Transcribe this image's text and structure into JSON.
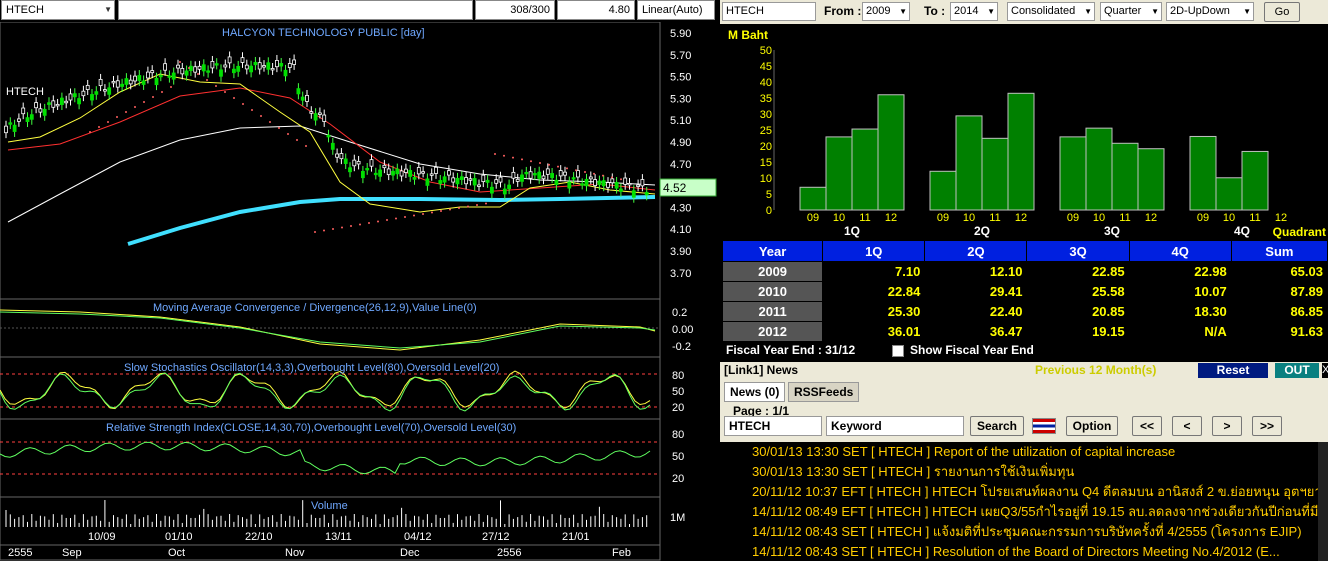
{
  "left_toolbar": {
    "symbol": "HTECH",
    "bars": "308/300",
    "value": "4.80",
    "scale": "Linear(Auto)"
  },
  "chart": {
    "title": "HALCYON TECHNOLOGY PUBLIC [day]",
    "symbol_label": "HTECH",
    "last_price": "4.52",
    "price_ticks": [
      "5.90",
      "5.70",
      "5.50",
      "5.30",
      "5.10",
      "4.90",
      "4.70",
      "4.50",
      "4.30",
      "4.10",
      "3.90",
      "3.70"
    ],
    "macd_title": "Moving Average Convergence / Divergence(26,12,9),Value Line(0)",
    "macd_ticks": [
      "0.2",
      "0.00",
      "-0.2"
    ],
    "stoch_title": "Slow Stochastics Oscillator(14,3,3),Overbought Level(80),Oversold Level(20)",
    "stoch_ticks": [
      "80",
      "50",
      "20"
    ],
    "rsi_title": "Relative Strength Index(CLOSE,14,30,70),Overbought Level(70),Oversold Level(30)",
    "rsi_ticks": [
      "80",
      "50",
      "20"
    ],
    "volume_title": "Volume",
    "volume_tick": "1M",
    "x_labels_top": [
      "10/09",
      "01/10",
      "22/10",
      "13/11",
      "04/12",
      "27/12",
      "21/01"
    ],
    "x_labels_bottom": [
      "2555",
      "Sep",
      "Oct",
      "Nov",
      "Dec",
      "2556",
      "Feb"
    ]
  },
  "right_toolbar": {
    "symbol": "HTECH",
    "from_label": "From :",
    "from_value": "2009",
    "to_label": "To :",
    "to_value": "2014",
    "basis": "Consolidated",
    "period": "Quarter",
    "view": "2D-UpDown",
    "go_label": "Go"
  },
  "chart_data": {
    "type": "bar",
    "ylabel": "M Baht",
    "xlabel": "Quadrant",
    "ylim": [
      0,
      50
    ],
    "y_ticks": [
      "0",
      "5",
      "10",
      "15",
      "20",
      "25",
      "30",
      "35",
      "40",
      "45",
      "50"
    ],
    "groups": [
      "1Q",
      "2Q",
      "3Q",
      "4Q"
    ],
    "years": [
      "09",
      "10",
      "11",
      "12"
    ],
    "values": {
      "1Q": [
        7.1,
        22.84,
        25.3,
        36.01
      ],
      "2Q": [
        12.1,
        29.41,
        22.4,
        36.47
      ],
      "3Q": [
        22.85,
        25.58,
        20.85,
        19.15
      ],
      "4Q": [
        22.98,
        10.07,
        18.3,
        null
      ]
    },
    "bar_color": "#008000"
  },
  "table": {
    "headers": [
      "Year",
      "1Q",
      "2Q",
      "3Q",
      "4Q",
      "Sum"
    ],
    "rows": [
      [
        "2009",
        "7.10",
        "12.10",
        "22.85",
        "22.98",
        "65.03"
      ],
      [
        "2010",
        "22.84",
        "29.41",
        "25.58",
        "10.07",
        "87.89"
      ],
      [
        "2011",
        "25.30",
        "22.40",
        "20.85",
        "18.30",
        "86.85"
      ],
      [
        "2012",
        "36.01",
        "36.47",
        "19.15",
        "N/A",
        "91.63"
      ]
    ]
  },
  "fiscal": {
    "label": "Fiscal  Year  End  :  31/12",
    "checkbox_label": "Show Fiscal Year End"
  },
  "news": {
    "header": "[Link1] News",
    "period": "Previous 12 Month(s)",
    "reset": "Reset",
    "out": "OUT",
    "close": "X",
    "tab_news": "News (0)",
    "tab_rss": "RSSFeeds",
    "page": "Page : 1/1",
    "symbol": "HTECH",
    "keyword": "Keyword",
    "search": "Search",
    "option": "Option",
    "nav": [
      "<<",
      "<",
      ">",
      ">>"
    ],
    "items": [
      "30/01/13 13:30  SET  [ HTECH ]  Report of the utilization of capital increase",
      "30/01/13 13:30  SET  [ HTECH ]  รายงานการใช้เงินเพิ่มทุน",
      "20/11/12 10:37  EFT  [ HTECH ]  HTECH โปรยเสนท์ผลงาน Q4 ดีตลมบน อานิสงส์ 2 ข.ย่อยหนุน อุตฯยานย...",
      "14/11/12 08:49  EFT  [ HTECH ]  HTECH เผยQ3/55กำไรอยู่ที่ 19.15 ลบ.ลดลงจากช่วงเดียวกันปีก่อนที่มีกำ...",
      "14/11/12 08:43  SET  [ HTECH ]  แจ้งมติที่ประชุมคณะกรรมการบริษัทครั้งที่ 4/2555 (โครงการ EJIP)",
      "14/11/12 08:43  SET  [ HTECH ]  Resolution of the Board of Directors  Meeting No.4/2012 (E..."
    ]
  }
}
